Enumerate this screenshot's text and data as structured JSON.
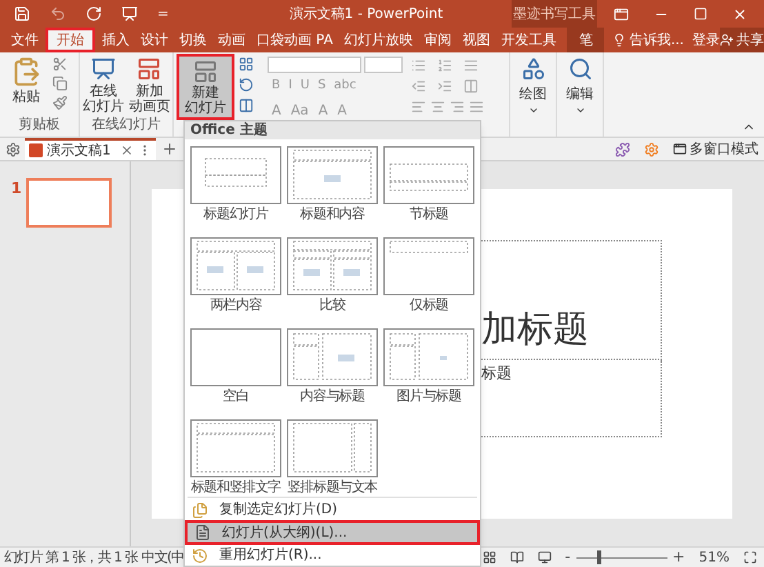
{
  "title_bar": {
    "title": "演示文稿1 - PowerPoint",
    "context_label": "墨迹书写工具",
    "customize": "="
  },
  "tabs": [
    {
      "label": "文件",
      "selected": false,
      "highlighted": false
    },
    {
      "label": "开始",
      "selected": true,
      "highlighted": true
    },
    {
      "label": "插入",
      "selected": false,
      "highlighted": false
    },
    {
      "label": "设计",
      "selected": false,
      "highlighted": false
    },
    {
      "label": "切换",
      "selected": false,
      "highlighted": false
    },
    {
      "label": "动画",
      "selected": false,
      "highlighted": false
    },
    {
      "label": "口袋动画 PA",
      "selected": false,
      "highlighted": false
    },
    {
      "label": "幻灯片放映",
      "selected": false,
      "highlighted": false
    },
    {
      "label": "审阅",
      "selected": false,
      "highlighted": false
    },
    {
      "label": "视图",
      "selected": false,
      "highlighted": false
    },
    {
      "label": "开发工具",
      "selected": false,
      "highlighted": false
    }
  ],
  "context_tab": {
    "label": "笔"
  },
  "tell_me": "告诉我...",
  "sign_in": "登录",
  "share": "共享",
  "ribbon": {
    "paste": "粘贴",
    "clipboard_group": "剪贴板",
    "online_slide": [
      "在线",
      "幻灯片"
    ],
    "new_anim_page": [
      "新加",
      "动画页"
    ],
    "online_group": "在线幻灯片",
    "new_slide": {
      "lines": [
        "新建",
        "幻灯片"
      ],
      "pressed": true,
      "highlighted": true
    },
    "font_row1": [
      "B",
      "I",
      "U",
      "S",
      "abc"
    ],
    "font_row2": [
      "A",
      "Aa",
      "A",
      "A"
    ],
    "draw": "绘图",
    "edit": "编辑"
  },
  "doc_tabs": [
    {
      "label": "演示文稿1",
      "selected": true
    }
  ],
  "multi_window": "多窗口模式",
  "thumbnails": [
    {
      "number": "1",
      "selected": true
    }
  ],
  "slide": {
    "title": "加标题",
    "subtitle": "标题"
  },
  "new_slide_menu": {
    "header": "Office 主题",
    "layouts": [
      {
        "label": "标题幻灯片",
        "kind": "title"
      },
      {
        "label": "标题和内容",
        "kind": "title-content"
      },
      {
        "label": "节标题",
        "kind": "section"
      },
      {
        "label": "两栏内容",
        "kind": "two-content"
      },
      {
        "label": "比较",
        "kind": "comparison"
      },
      {
        "label": "仅标题",
        "kind": "title-only"
      },
      {
        "label": "空白",
        "kind": "blank"
      },
      {
        "label": "内容与标题",
        "kind": "content-caption"
      },
      {
        "label": "图片与标题",
        "kind": "picture-caption"
      },
      {
        "label": "标题和竖排文字",
        "kind": "vertical-text"
      },
      {
        "label": "竖排标题与文本",
        "kind": "vertical-title"
      }
    ],
    "items": [
      {
        "label": "复制选定幻灯片(D)",
        "kind": "duplicate",
        "selected": false,
        "highlighted": false
      },
      {
        "label": "幻灯片(从大纲)(L)...",
        "kind": "outline",
        "selected": true,
        "highlighted": true
      },
      {
        "label": "重用幻灯片(R)...",
        "kind": "reuse",
        "selected": false,
        "highlighted": false
      }
    ]
  },
  "status_bar": {
    "slide_info": "幻灯片 第 1 张，共 1 张",
    "language": "中文(中",
    "zoom_minus": "-",
    "zoom_plus": "+",
    "zoom": "51%",
    "zoom_slider": {
      "level": 0.25
    }
  }
}
